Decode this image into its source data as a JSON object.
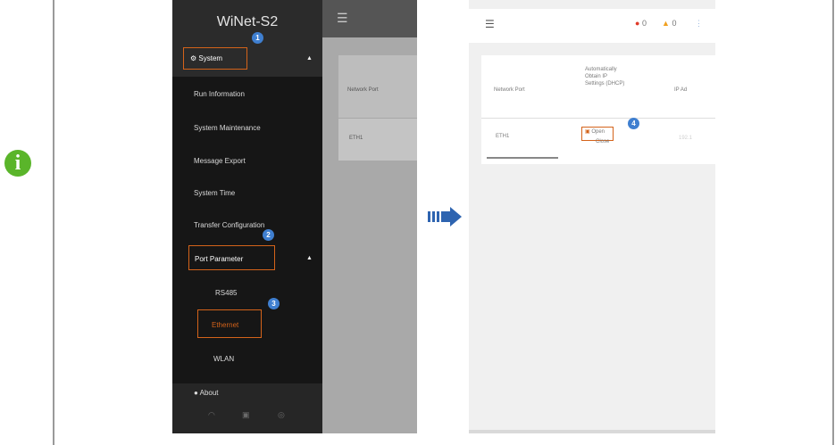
{
  "page": {
    "info_icon": "info-icon"
  },
  "phone1": {
    "app_title": "WiNet-S2",
    "menu": {
      "system": "System",
      "run_information": "Run Information",
      "system_maintenance": "System Maintenance",
      "message_export": "Message Export",
      "system_time": "System Time",
      "transfer_configuration": "Transfer Configuration",
      "port_parameter": "Port Parameter",
      "rs485": "RS485",
      "ethernet": "Ethernet",
      "wlan": "WLAN",
      "about": "About"
    },
    "badges": [
      "1",
      "2",
      "3"
    ],
    "table": {
      "col_network_port": "Network Port",
      "row_port": "ETH1"
    }
  },
  "phone2": {
    "alarm_red": "0",
    "alarm_yellow": "0",
    "table": {
      "col_network_port": "Network Port",
      "col_dhcp": "Automatically Obtain IP Settings (DHCP)",
      "col_ip": "IP Ad",
      "row_port": "ETH1",
      "option_open": "Open",
      "option_close": "Close",
      "row_ip": "192.1"
    },
    "badge": "4"
  },
  "colors": {
    "highlight": "#d4631a",
    "badge": "#3f7fd0",
    "info": "#5ab52a",
    "arrow": "#2e64b0"
  }
}
